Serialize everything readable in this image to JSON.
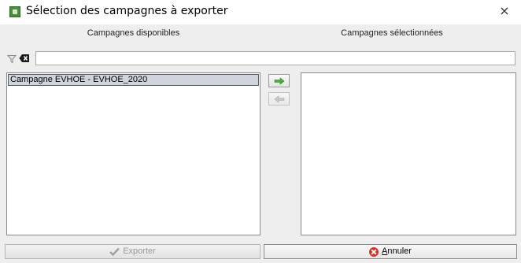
{
  "window": {
    "title": "Sélection des campagnes à exporter",
    "close_label": "×"
  },
  "columns": {
    "available_header": "Campagnes disponibles",
    "selected_header": "Campagnes sélectionnées"
  },
  "filter": {
    "value": "",
    "icons": [
      "filter-icon",
      "clear-filter-icon"
    ]
  },
  "available_list": {
    "items": [
      "Campagne EVHOE - EVHOE_2020"
    ],
    "selected_index": 0
  },
  "selected_list": {
    "items": []
  },
  "transfer": {
    "add_icon": "arrow-right-icon",
    "remove_icon": "arrow-left-icon",
    "add_color": "#3a9a2a"
  },
  "buttons": {
    "export_label": "Exporter",
    "export_enabled": false,
    "cancel_mnemonic": "A",
    "cancel_rest": "nnuler",
    "cancel_icon_color": "#d93025"
  }
}
